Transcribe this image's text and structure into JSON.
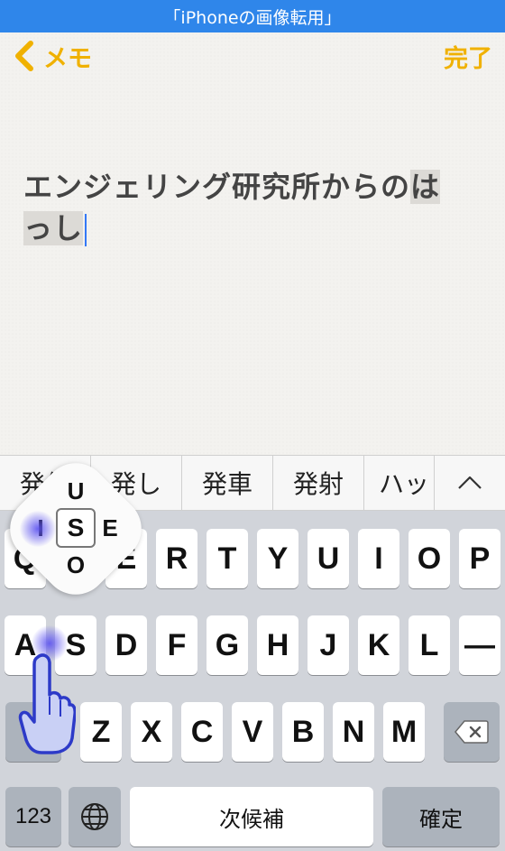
{
  "caption": "「iPhoneの画像転用」",
  "nav": {
    "back_label": "メモ",
    "done_label": "完了",
    "accent_color": "#f0b100"
  },
  "note": {
    "text_main": "エンジェリング研究所からの",
    "text_marked_1": "は",
    "text_marked_2": "っし"
  },
  "candidates": [
    "発信",
    "発し",
    "発車",
    "発射",
    "ハッ"
  ],
  "keyboard": {
    "row1": [
      "Q",
      "W",
      "E",
      "R",
      "T",
      "Y",
      "U",
      "I",
      "O",
      "P"
    ],
    "row2": [
      "A",
      "S",
      "D",
      "F",
      "G",
      "H",
      "J",
      "K",
      "L",
      "—"
    ],
    "row3": [
      "Z",
      "X",
      "C",
      "V",
      "B",
      "N",
      "M"
    ],
    "numbers_label": "123",
    "space_label": "次候補",
    "return_label": "確定"
  },
  "flick_popup": {
    "up": "U",
    "left": "I",
    "center": "S",
    "right": "E",
    "down": "O"
  }
}
